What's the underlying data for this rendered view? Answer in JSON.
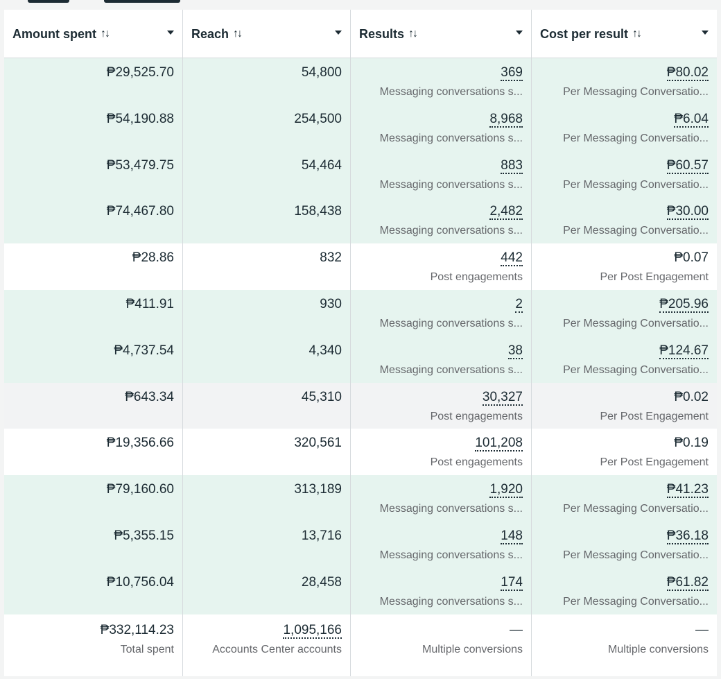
{
  "columns": [
    {
      "label": "Amount spent",
      "sort_icon": "sort-arrows-icon"
    },
    {
      "label": "Reach",
      "sort_icon": "sort-arrows-icon"
    },
    {
      "label": "Results",
      "sort_icon": "sort-arrows-icon"
    },
    {
      "label": "Cost per result",
      "sort_icon": "sort-arrows-icon"
    }
  ],
  "sort_glyph": "↑↓",
  "colors": {
    "highlight_row": "#e6f4ef",
    "muted_row": "#f2f3f4",
    "text": "#1c2b33",
    "subtext": "#65676b"
  },
  "rows": [
    {
      "style": "green",
      "amount": "₱29,525.70",
      "reach": "54,800",
      "results": "369",
      "results_label": "Messaging conversations s...",
      "cost": "₱80.02",
      "cost_label": "Per Messaging Conversatio...",
      "cost_dotted": true
    },
    {
      "style": "green",
      "amount": "₱54,190.88",
      "reach": "254,500",
      "results": "8,968",
      "results_label": "Messaging conversations s...",
      "cost": "₱6.04",
      "cost_label": "Per Messaging Conversatio...",
      "cost_dotted": true
    },
    {
      "style": "green",
      "amount": "₱53,479.75",
      "reach": "54,464",
      "results": "883",
      "results_label": "Messaging conversations s...",
      "cost": "₱60.57",
      "cost_label": "Per Messaging Conversatio...",
      "cost_dotted": true
    },
    {
      "style": "green",
      "amount": "₱74,467.80",
      "reach": "158,438",
      "results": "2,482",
      "results_label": "Messaging conversations s...",
      "cost": "₱30.00",
      "cost_label": "Per Messaging Conversatio...",
      "cost_dotted": true
    },
    {
      "style": "white",
      "amount": "₱28.86",
      "reach": "832",
      "results": "442",
      "results_label": "Post engagements",
      "cost": "₱0.07",
      "cost_label": "Per Post Engagement",
      "cost_dotted": false
    },
    {
      "style": "green",
      "amount": "₱411.91",
      "reach": "930",
      "results": "2",
      "results_label": "Messaging conversations s...",
      "cost": "₱205.96",
      "cost_label": "Per Messaging Conversatio...",
      "cost_dotted": true
    },
    {
      "style": "green",
      "amount": "₱4,737.54",
      "reach": "4,340",
      "results": "38",
      "results_label": "Messaging conversations s...",
      "cost": "₱124.67",
      "cost_label": "Per Messaging Conversatio...",
      "cost_dotted": true
    },
    {
      "style": "gray",
      "amount": "₱643.34",
      "reach": "45,310",
      "results": "30,327",
      "results_label": "Post engagements",
      "cost": "₱0.02",
      "cost_label": "Per Post Engagement",
      "cost_dotted": false
    },
    {
      "style": "white",
      "amount": "₱19,356.66",
      "reach": "320,561",
      "results": "101,208",
      "results_label": "Post engagements",
      "cost": "₱0.19",
      "cost_label": "Per Post Engagement",
      "cost_dotted": false
    },
    {
      "style": "green",
      "amount": "₱79,160.60",
      "reach": "313,189",
      "results": "1,920",
      "results_label": "Messaging conversations s...",
      "cost": "₱41.23",
      "cost_label": "Per Messaging Conversatio...",
      "cost_dotted": true
    },
    {
      "style": "green",
      "amount": "₱5,355.15",
      "reach": "13,716",
      "results": "148",
      "results_label": "Messaging conversations s...",
      "cost": "₱36.18",
      "cost_label": "Per Messaging Conversatio...",
      "cost_dotted": true
    },
    {
      "style": "green",
      "amount": "₱10,756.04",
      "reach": "28,458",
      "results": "174",
      "results_label": "Messaging conversations s...",
      "cost": "₱61.82",
      "cost_label": "Per Messaging Conversatio...",
      "cost_dotted": true
    }
  ],
  "totals": {
    "amount": "₱332,114.23",
    "amount_label": "Total spent",
    "reach": "1,095,166",
    "reach_label": "Accounts Center accounts",
    "results": "—",
    "results_label": "Multiple conversions",
    "cost": "—",
    "cost_label": "Multiple conversions"
  }
}
